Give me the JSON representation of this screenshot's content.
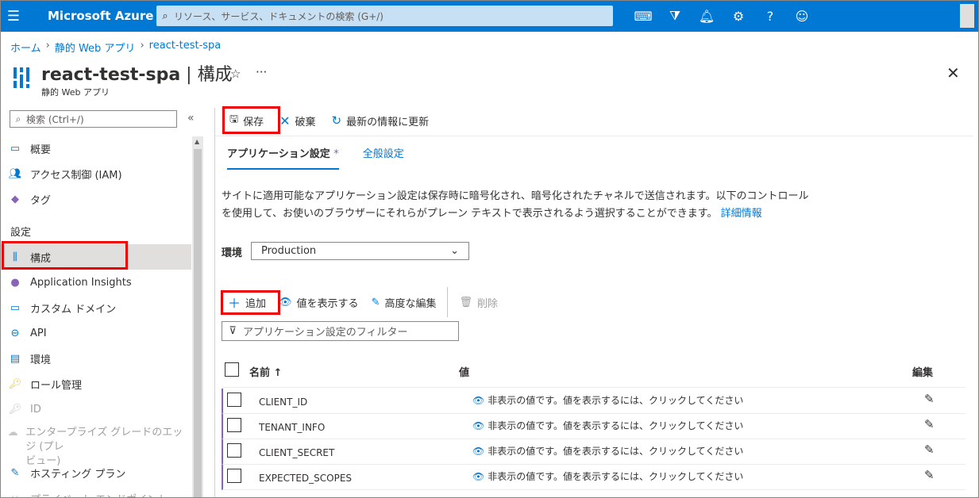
{
  "topbar": {
    "brand": "Microsoft Azure",
    "search_placeholder": "リソース、サービス、ドキュメントの検索 (G+/)",
    "icons": [
      "cloud-shell-icon",
      "directory-filter-icon",
      "bell-icon",
      "gear-icon",
      "help-icon",
      "feedback-icon"
    ]
  },
  "breadcrumb": {
    "home": "ホーム",
    "static_web_apps": "静的 Web アプリ",
    "resource": "react-test-spa"
  },
  "header": {
    "title": "react-test-spa",
    "separator": " | ",
    "section": "構成",
    "subtitle": "静的 Web アプリ"
  },
  "sidebar": {
    "search_placeholder": "検索 (Ctrl+/)",
    "items_top": [
      {
        "label": "概要",
        "icon": "overview-icon"
      },
      {
        "label": "アクセス制御 (IAM)",
        "icon": "iam-icon"
      },
      {
        "label": "タグ",
        "icon": "tag-icon"
      }
    ],
    "section_settings": "設定",
    "items_settings": [
      {
        "label": "構成",
        "icon": "config-icon"
      },
      {
        "label": "Application Insights",
        "icon": "app-insights-icon"
      },
      {
        "label": "カスタム ドメイン",
        "icon": "custom-domain-icon"
      },
      {
        "label": "API",
        "icon": "api-icon"
      },
      {
        "label": "環境",
        "icon": "environment-icon"
      },
      {
        "label": "ロール管理",
        "icon": "role-icon"
      },
      {
        "label": "ID",
        "icon": "identity-icon"
      },
      {
        "label": "エンタープライズ グレードのエッジ (プレ",
        "label2": "ビュー)",
        "icon": "edge-icon"
      },
      {
        "label": "ホスティング プラン",
        "icon": "hosting-plan-icon"
      },
      {
        "label": "プライベート エンドポイント",
        "icon": "private-endpoint-icon"
      }
    ]
  },
  "toolbar": {
    "save": "保存",
    "discard": "破棄",
    "refresh": "最新の情報に更新"
  },
  "tabs": {
    "app_settings": "アプリケーション設定",
    "app_settings_modified": "*",
    "general_settings": "全般設定"
  },
  "description": {
    "line1": "サイトに適用可能なアプリケーション設定は保存時に暗号化され、暗号化されたチャネルで送信されます。以下のコントロール",
    "line2": "を使用して、お使いのブラウザーにそれらがプレーン テキストで表示されるよう選択することができます。",
    "link": "詳細情報"
  },
  "environment": {
    "label": "環境",
    "selected": "Production"
  },
  "commands": {
    "add": "追加",
    "show_values": "値を表示する",
    "advanced_edit": "高度な編集",
    "delete": "削除"
  },
  "filter": {
    "placeholder": "アプリケーション設定のフィルター"
  },
  "table": {
    "col_name": "名前 ↑",
    "col_value": "値",
    "col_edit": "編集",
    "rows": [
      {
        "name": "CLIENT_ID",
        "value": "非表示の値です。値を表示するには、クリックしてください"
      },
      {
        "name": "TENANT_INFO",
        "value": "非表示の値です。値を表示するには、クリックしてください"
      },
      {
        "name": "CLIENT_SECRET",
        "value": "非表示の値です。値を表示するには、クリックしてください"
      },
      {
        "name": "EXPECTED_SCOPES",
        "value": "非表示の値です。値を表示するには、クリックしてください"
      }
    ]
  },
  "colors": {
    "azure_blue": "#0078d4",
    "highlight_red": "#e00000",
    "modified_purple": "#8764b8"
  }
}
